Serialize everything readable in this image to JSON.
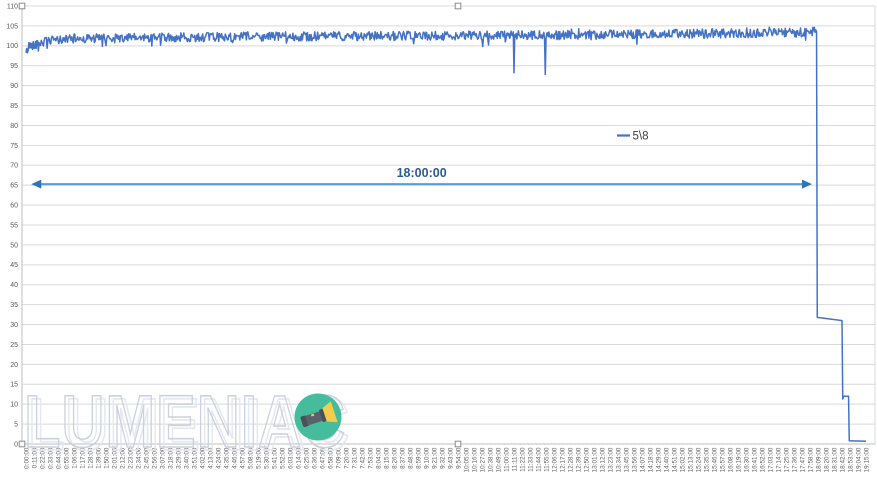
{
  "window": {
    "background": "#FFFFFF"
  },
  "watermark": {
    "text": "LUMENIAC",
    "logo": "flashlight-in-teal-circle"
  },
  "chart_data": {
    "type": "line",
    "title": "",
    "legend": {
      "label": "5\\8",
      "position": "center-middle"
    },
    "x_axis": {
      "first_tick": "0:00:00",
      "last_tick": "19:15:00",
      "tick_step_minutes": 11,
      "tick_count": 106,
      "total_minutes": 1155,
      "labels_rotation_deg": -90
    },
    "y_axis": {
      "min": 0,
      "max": 110,
      "tick_step": 5,
      "grid": true
    },
    "series": [
      {
        "name": "5\\8",
        "color": "#4472C4",
        "description": "relative output %, stable ~100-104 for ~18h, stepdown to ~32, then ~12, then ~1",
        "key_points": [
          [
            0,
            98
          ],
          [
            4,
            100
          ],
          [
            25,
            101
          ],
          [
            60,
            101.8
          ],
          [
            300,
            102.3
          ],
          [
            660,
            102.6
          ],
          [
            1060,
            103.3
          ],
          [
            1087,
            103.6
          ],
          [
            1088,
            31.8
          ],
          [
            1122,
            31
          ],
          [
            1123,
            11.3
          ],
          [
            1124,
            12
          ],
          [
            1131,
            12
          ],
          [
            1132,
            0.8
          ],
          [
            1155,
            0.7
          ]
        ],
        "dips": [
          [
            671,
            93.2
          ],
          [
            714,
            92.8
          ]
        ],
        "noise": {
          "amplitude": 1.15,
          "spike_chance": 0.05,
          "spike_scale": 3.2,
          "until_minute": 1086,
          "seed": 42
        },
        "clamp": [
          98.2,
          105.6
        ]
      }
    ],
    "annotations": [
      {
        "type": "double-arrow",
        "label": "18:00:00",
        "y_value": 65,
        "from_minute": 10,
        "to_minute": 1078
      }
    ],
    "colors": {
      "series": "#4472C4",
      "gridline": "#D9D9D9",
      "axis_line": "#BFBFBF",
      "axis_label": "#595959",
      "legend_text": "#3B3B3B",
      "arrow_line": "#5B9BD5",
      "arrow_head": "#2E75B6",
      "arrow_label_text": "#2E5B8F",
      "watermark_outline": "#C7CEDC",
      "watermark_shadow": "#E2E6EF",
      "logo_circle": "#45BD9D",
      "logo_body": "#5A616C",
      "logo_head": "#F2CC4C"
    },
    "selection_handles": {
      "shown": true,
      "positions": [
        "top-left",
        "top-center",
        "bottom-left",
        "bottom-center"
      ]
    }
  }
}
